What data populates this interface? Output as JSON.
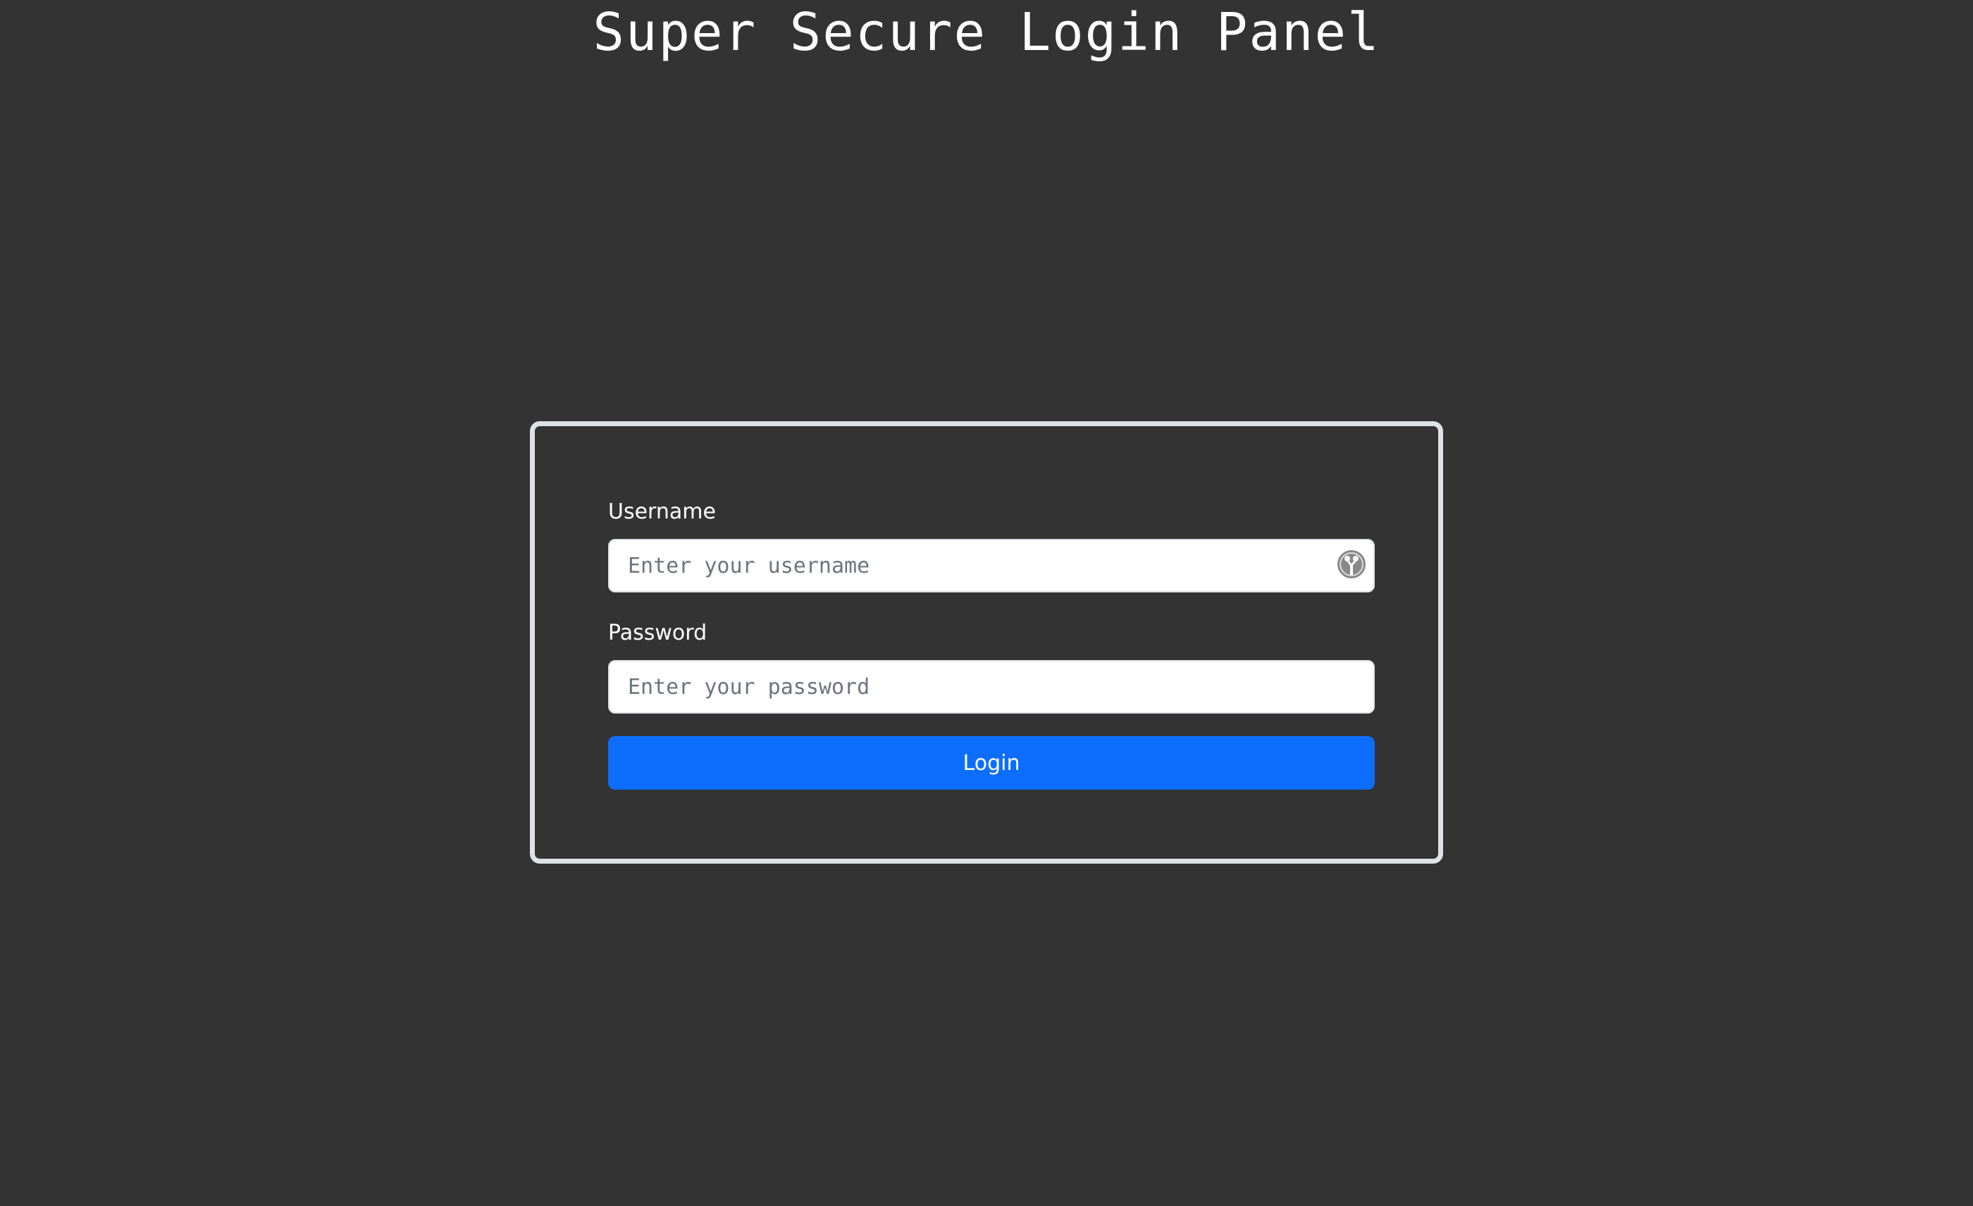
{
  "page": {
    "title": "Super Secure Login Panel"
  },
  "form": {
    "username": {
      "label": "Username",
      "placeholder": "Enter your username",
      "value": ""
    },
    "password": {
      "label": "Password",
      "placeholder": "Enter your password",
      "value": ""
    },
    "submit_label": "Login"
  },
  "icons": {
    "username_field_icon": "password-manager-key-icon"
  },
  "colors": {
    "background": "#333333",
    "card_border": "#dee2e6",
    "button": "#0d6efd",
    "text": "#ffffff"
  }
}
